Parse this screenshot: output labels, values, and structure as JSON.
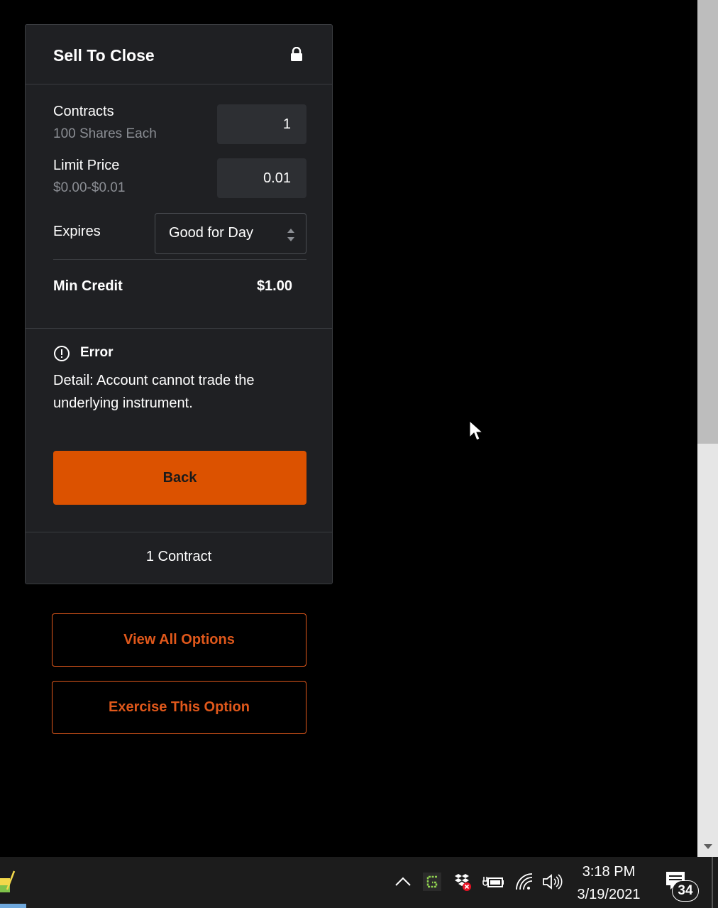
{
  "order_panel": {
    "title": "Sell To Close",
    "contracts": {
      "label": "Contracts",
      "sub": "100 Shares Each",
      "value": "1"
    },
    "limit_price": {
      "label": "Limit Price",
      "sub": "$0.00-$0.01",
      "value": "0.01"
    },
    "expires": {
      "label": "Expires",
      "selected": "Good for Day"
    },
    "min_credit": {
      "label": "Min Credit",
      "value": "$1.00"
    },
    "error": {
      "title": "Error",
      "detail": "Detail: Account cannot trade the underlying instrument."
    },
    "back_label": "Back",
    "footer": "1 Contract"
  },
  "actions": {
    "view_all_options": "View All Options",
    "exercise_option": "Exercise This Option"
  },
  "taskbar": {
    "time": "3:18 PM",
    "date": "3/19/2021",
    "notification_count": "34"
  },
  "colors": {
    "accent": "#dc5200",
    "panel_bg": "#1f2023",
    "page_bg": "#000000"
  }
}
